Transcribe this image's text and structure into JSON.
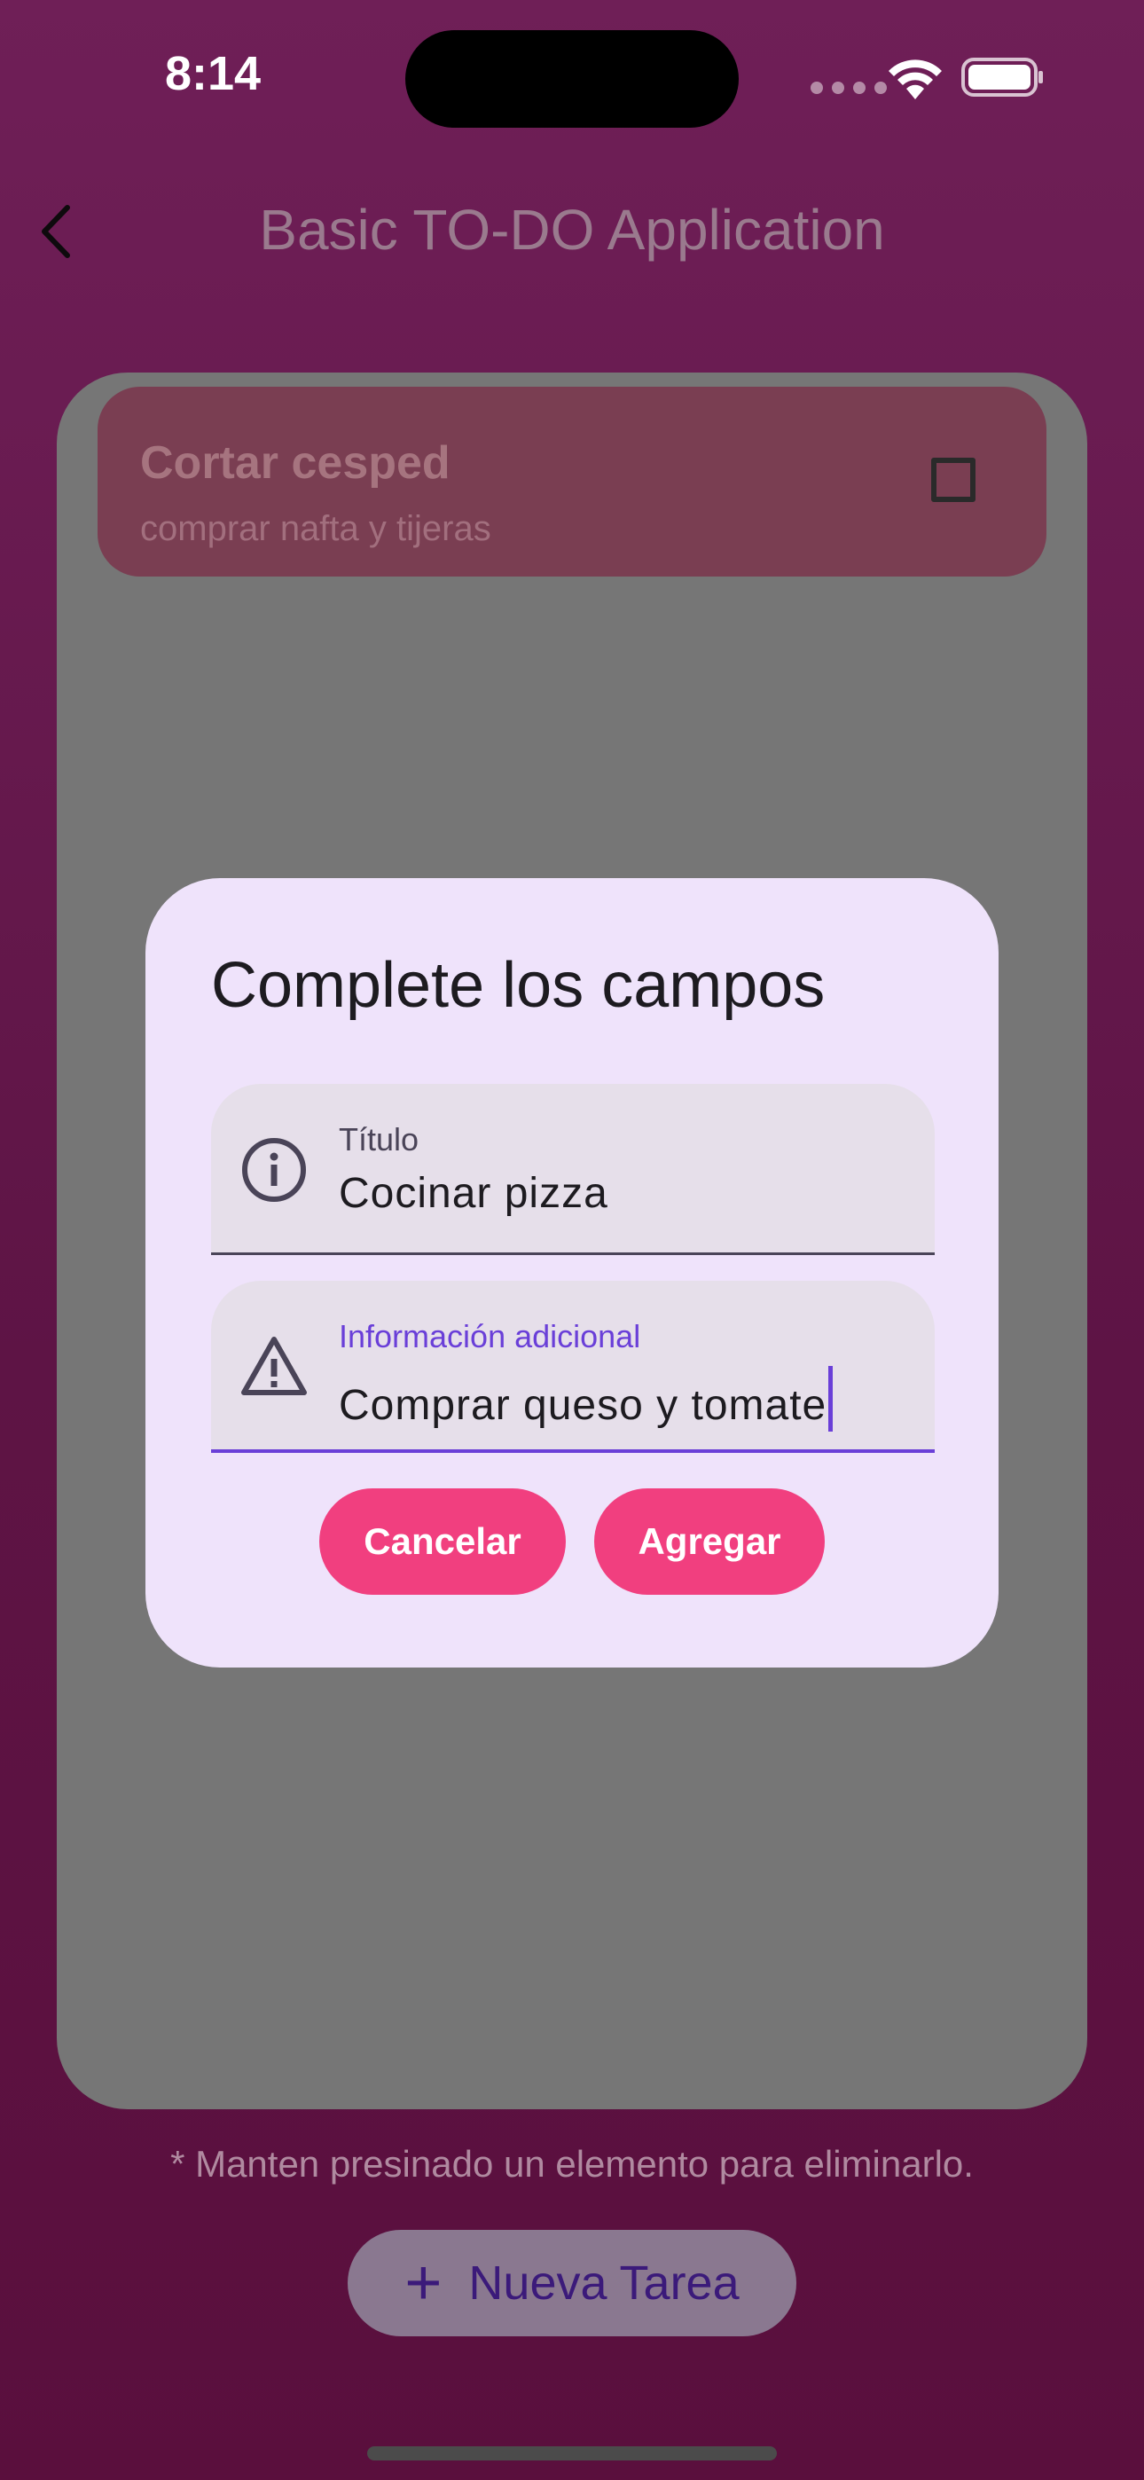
{
  "status": {
    "time": "8:14"
  },
  "appbar": {
    "title": "Basic TO-DO Application"
  },
  "tasks": [
    {
      "title": "Cortar cesped",
      "subtitle": "comprar nafta y tijeras",
      "done": false
    }
  ],
  "hint": "* Manten presinado un elemento para eliminarlo.",
  "fab": {
    "icon": "+",
    "label": "Nueva Tarea"
  },
  "dialog": {
    "title": "Complete los campos",
    "fields": [
      {
        "label": "Título",
        "value": "Cocinar pizza",
        "icon": "info-icon"
      },
      {
        "label": "Información adicional",
        "value": "Comprar queso y tomate",
        "icon": "warning-icon"
      }
    ],
    "cancel_label": "Cancelar",
    "add_label": "Agregar"
  },
  "colors": {
    "accent_button": "#f13f7f",
    "focus": "#6a3fd8",
    "dialog_bg": "#efe3fb"
  }
}
